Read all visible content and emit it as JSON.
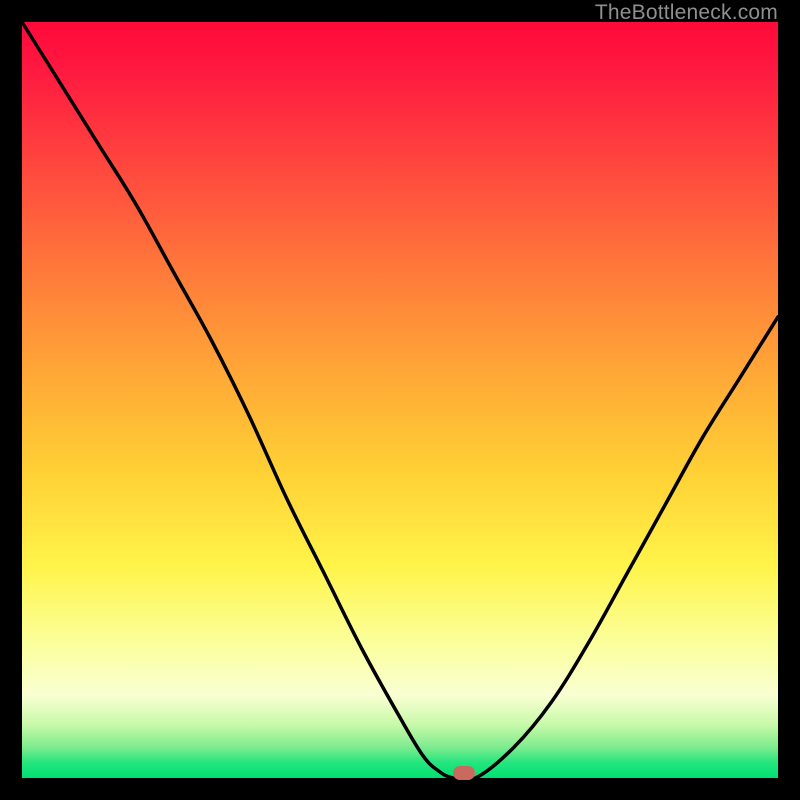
{
  "watermark": "TheBottleneck.com",
  "colors": {
    "background": "#000000",
    "gradient_top": "#ff0a3a",
    "gradient_mid1": "#ff7a3a",
    "gradient_mid2": "#ffd235",
    "gradient_mid3": "#fbff9a",
    "gradient_bottom": "#00e173",
    "curve": "#000000",
    "marker": "#c86b5e"
  },
  "chart_data": {
    "type": "line",
    "title": "",
    "xlabel": "",
    "ylabel": "",
    "xlim": [
      0,
      100
    ],
    "ylim": [
      0,
      100
    ],
    "grid": false,
    "legend": false,
    "annotations": [
      "TheBottleneck.com"
    ],
    "series": [
      {
        "name": "bottleneck-curve",
        "x": [
          0,
          5,
          10,
          15,
          20,
          25,
          30,
          35,
          40,
          45,
          50,
          53,
          55,
          57,
          60,
          65,
          70,
          75,
          80,
          85,
          90,
          95,
          100
        ],
        "values": [
          100,
          92,
          84,
          76,
          67,
          58,
          48,
          37,
          27,
          17,
          8,
          3,
          1,
          0,
          0,
          4,
          10,
          18,
          27,
          36,
          45,
          53,
          61
        ]
      }
    ],
    "marker": {
      "x": 58.5,
      "y": 0.6
    }
  }
}
